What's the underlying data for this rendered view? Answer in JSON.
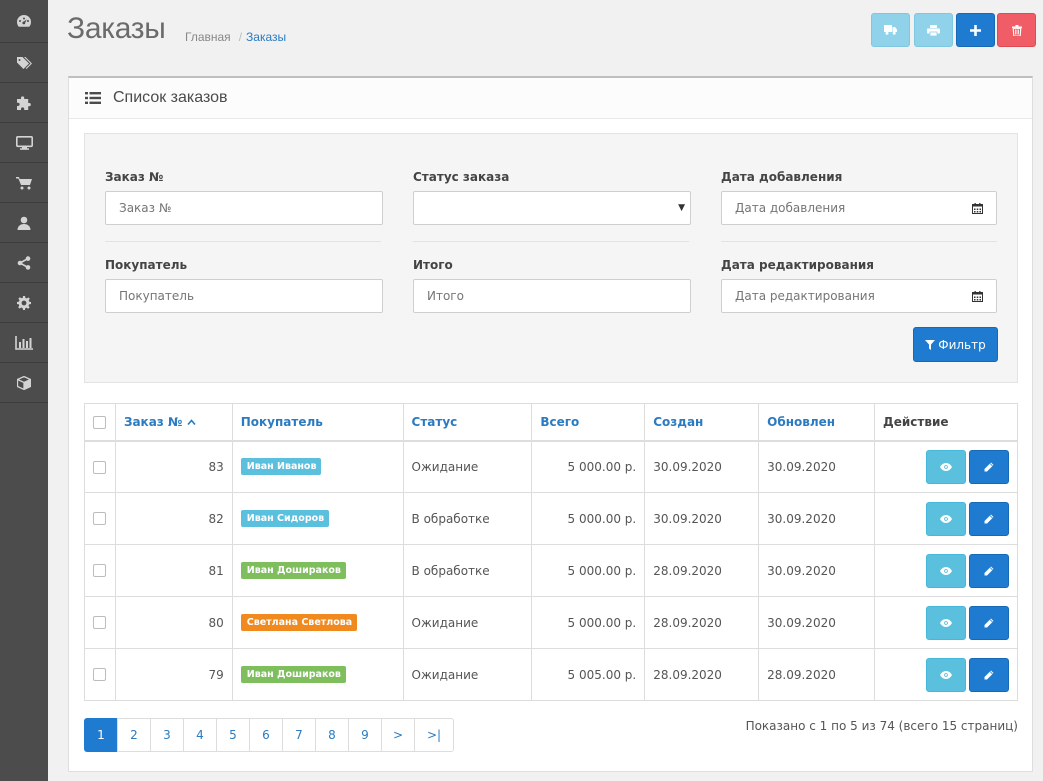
{
  "sidebar": {
    "icons": [
      "dashboard-icon",
      "tags-icon",
      "puzzle-icon",
      "desktop-icon",
      "cart-icon",
      "user-icon",
      "share-icon",
      "gear-icon",
      "bar-chart-icon",
      "cube-icon"
    ]
  },
  "header": {
    "title": "Заказы",
    "breadcrumb": {
      "home": "Главная",
      "separator": "/",
      "current": "Заказы"
    }
  },
  "toolbar": {
    "buttons": [
      "truck-icon",
      "print-icon",
      "plus-icon",
      "trash-icon"
    ],
    "colors": {
      "info": "#8fd2ea",
      "primary": "#1e7bd0",
      "danger": "#f05d66"
    }
  },
  "panel": {
    "title": "Список заказов"
  },
  "filter": {
    "order_id": {
      "label": "Заказ №",
      "placeholder": "Заказ №"
    },
    "status": {
      "label": "Статус заказа",
      "value": ""
    },
    "date_added": {
      "label": "Дата добавления",
      "placeholder": "Дата добавления"
    },
    "customer": {
      "label": "Покупатель",
      "placeholder": "Покупатель"
    },
    "total": {
      "label": "Итого",
      "placeholder": "Итого"
    },
    "date_modified": {
      "label": "Дата редактирования",
      "placeholder": "Дата редактирования"
    },
    "button": "Фильтр"
  },
  "table": {
    "columns": {
      "order_id": "Заказ №",
      "customer": "Покупатель",
      "status": "Статус",
      "total": "Всего",
      "date_added": "Создан",
      "date_modified": "Обновлен",
      "action": "Действие"
    },
    "sort_indicator": "^",
    "rows": [
      {
        "id": "83",
        "customer": "Иван Иванов",
        "badge_color": "#5bc0de",
        "status": "Ожидание",
        "total": "5 000.00 р.",
        "created": "30.09.2020",
        "updated": "30.09.2020"
      },
      {
        "id": "82",
        "customer": "Иван Сидоров",
        "badge_color": "#5bc0de",
        "status": "В обработке",
        "total": "5 000.00 р.",
        "created": "30.09.2020",
        "updated": "30.09.2020"
      },
      {
        "id": "81",
        "customer": "Иван Дошираков",
        "badge_color": "#7ebe5c",
        "status": "В обработке",
        "total": "5 000.00 р.",
        "created": "28.09.2020",
        "updated": "30.09.2020"
      },
      {
        "id": "80",
        "customer": "Светлана Светлова",
        "badge_color": "#f0891e",
        "status": "Ожидание",
        "total": "5 000.00 р.",
        "created": "28.09.2020",
        "updated": "30.09.2020"
      },
      {
        "id": "79",
        "customer": "Иван Дошираков",
        "badge_color": "#7ebe5c",
        "status": "Ожидание",
        "total": "5 005.00 р.",
        "created": "28.09.2020",
        "updated": "28.09.2020"
      }
    ]
  },
  "pagination": {
    "pages": [
      "1",
      "2",
      "3",
      "4",
      "5",
      "6",
      "7",
      "8",
      "9",
      ">",
      ">|"
    ],
    "active": "1",
    "info": "Показано с 1 по 5 из 74 (всего 15 страниц)"
  }
}
